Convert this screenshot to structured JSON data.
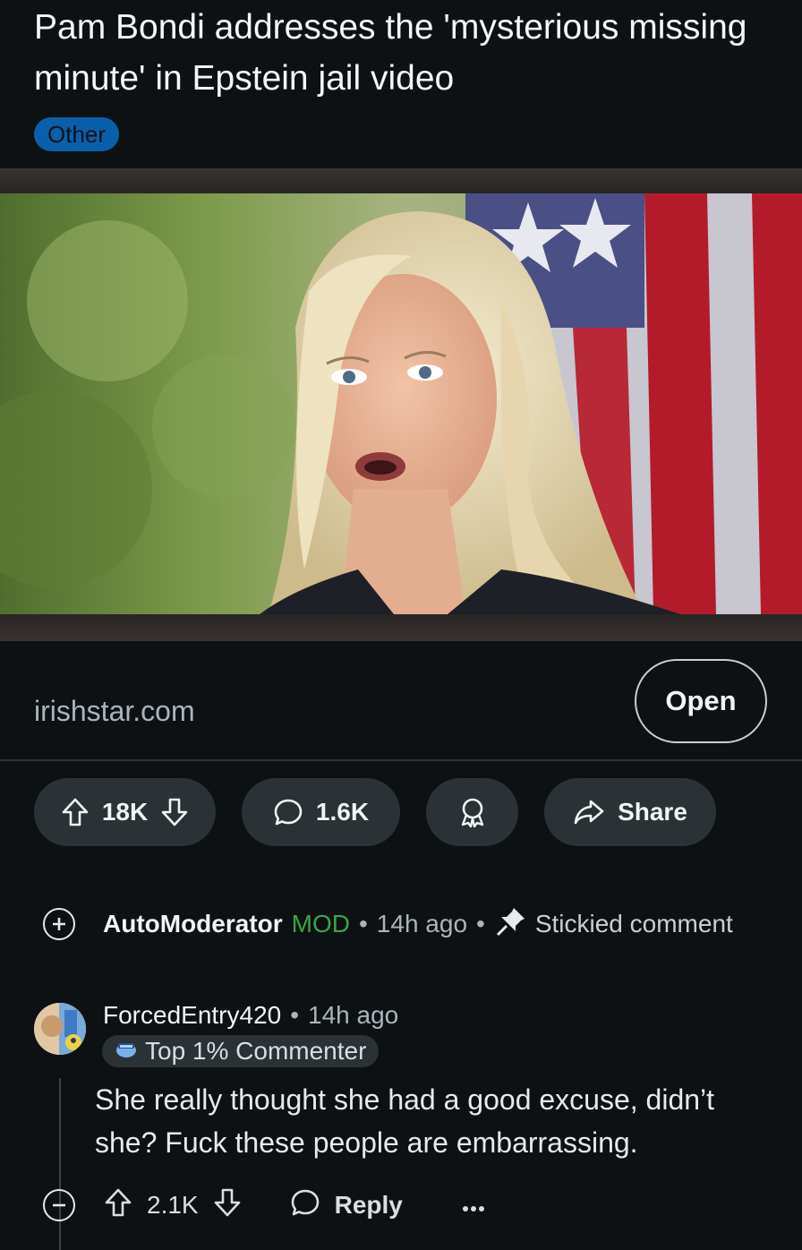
{
  "post": {
    "title": "Pam Bondi addresses the 'mysterious missing minute' in Epstein jail video",
    "flair": "Other",
    "link_domain": "irishstar.com",
    "open_label": "Open"
  },
  "actions": {
    "upvotes": "18K",
    "comments": "1.6K",
    "share_label": "Share"
  },
  "mod_comment": {
    "username": "AutoModerator",
    "tag": "MOD",
    "time": "14h ago",
    "label": "Stickied comment"
  },
  "comment": {
    "username": "ForcedEntry420",
    "time": "14h ago",
    "badge": "Top 1% Commenter",
    "body": "She really thought she had a good excuse, didn’t she? Fuck these people are embarrassing.",
    "score": "2.1K",
    "reply_label": "Reply"
  },
  "colors": {
    "background": "#0e1113",
    "flair": "#0a5fab",
    "mod_green": "#3aa347",
    "pill": "#2a3236"
  },
  "icons": [
    "upvote-icon",
    "downvote-icon",
    "comment-icon",
    "award-icon",
    "share-icon",
    "expand-icon",
    "pin-icon",
    "collapse-icon",
    "more-icon"
  ]
}
